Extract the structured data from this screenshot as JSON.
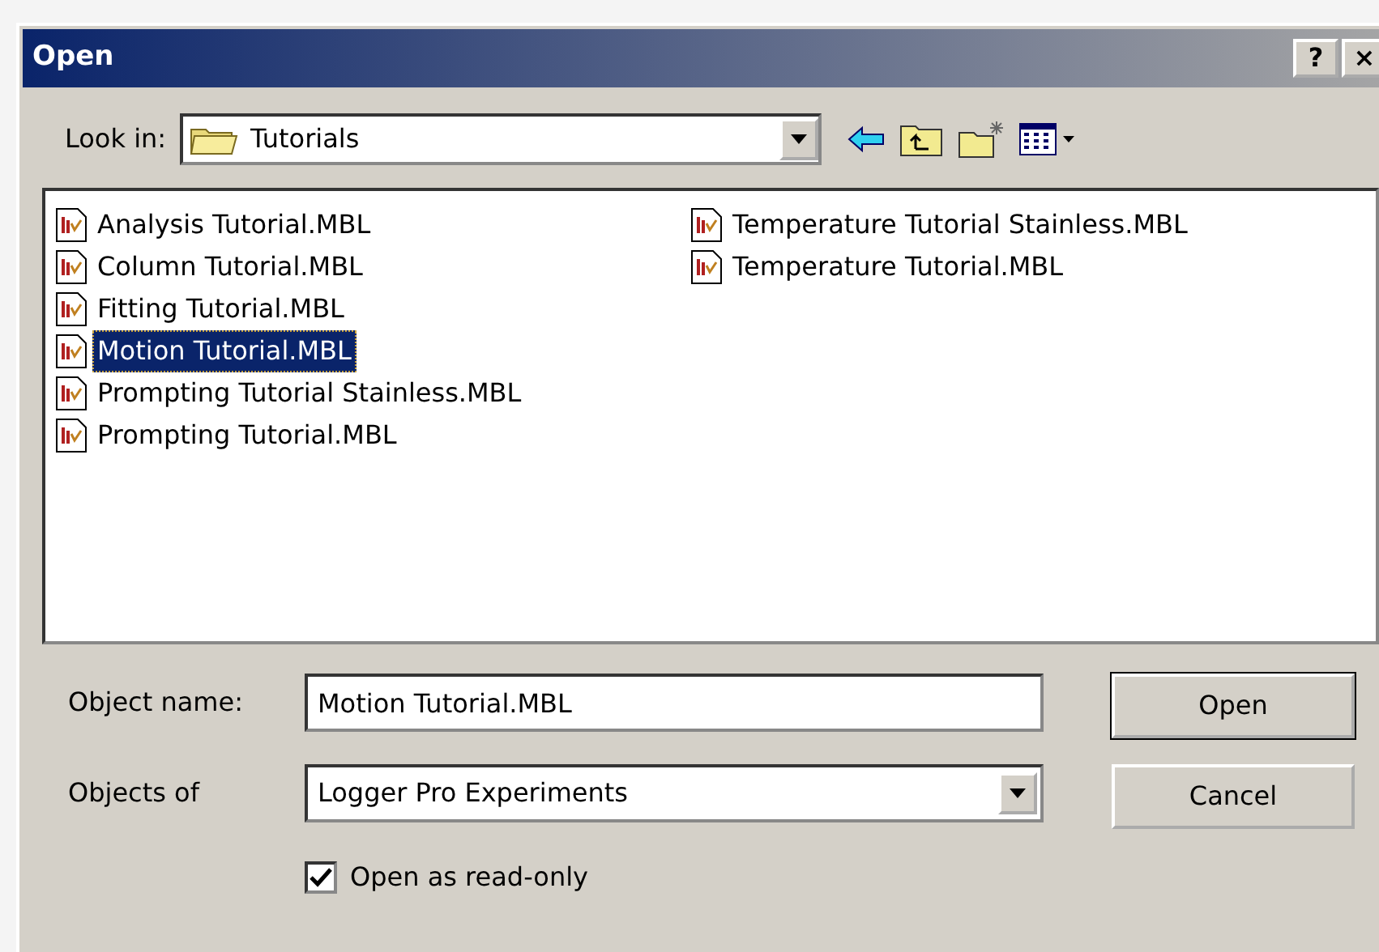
{
  "window": {
    "title": "Open",
    "buttons": [
      "?",
      "×"
    ]
  },
  "look_in": {
    "label": "Look in:",
    "value": "Tutorials"
  },
  "files": [
    {
      "name": "Analysis Tutorial.MBL",
      "selected": false
    },
    {
      "name": "Column Tutorial.MBL",
      "selected": false
    },
    {
      "name": "Fitting Tutorial.MBL",
      "selected": false
    },
    {
      "name": "Motion Tutorial.MBL",
      "selected": true
    },
    {
      "name": "Prompting Tutorial Stainless.MBL",
      "selected": false
    },
    {
      "name": "Prompting Tutorial.MBL",
      "selected": false
    },
    {
      "name": "Temperature Tutorial Stainless.MBL",
      "selected": false
    },
    {
      "name": "Temperature Tutorial.MBL",
      "selected": false
    }
  ],
  "object_name": {
    "label": "Object name:",
    "value": "Motion Tutorial.MBL"
  },
  "objects_of": {
    "label": "Objects of",
    "value": "Logger Pro Experiments"
  },
  "read_only": {
    "label": "Open as read-only",
    "checked": true
  },
  "buttons": [
    {
      "label": "Open",
      "default": true
    },
    {
      "label": "Cancel",
      "default": false
    }
  ]
}
